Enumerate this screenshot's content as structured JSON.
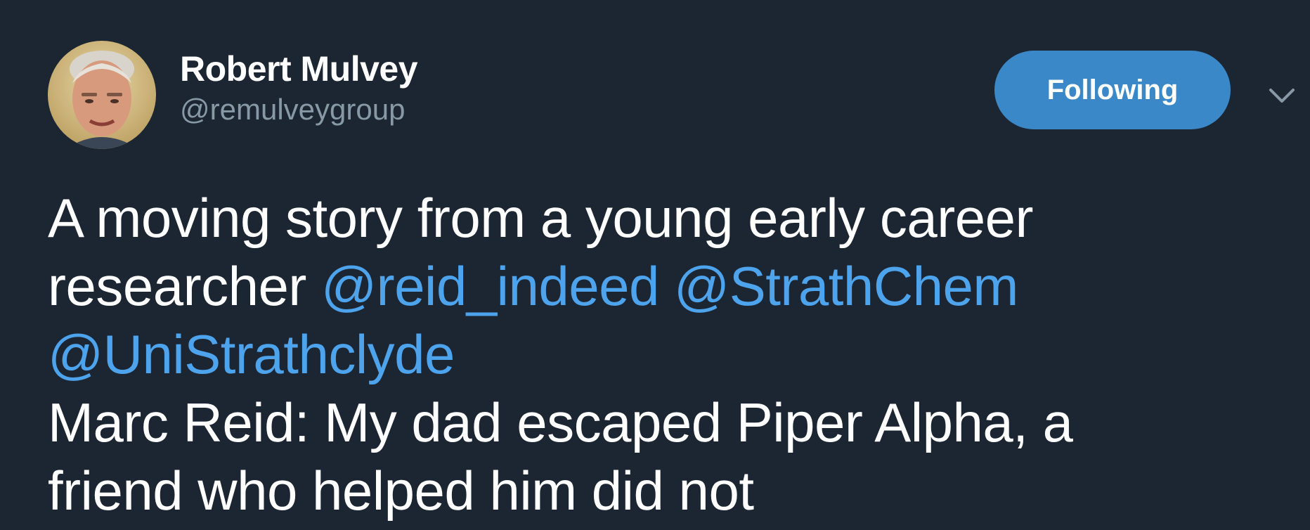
{
  "author": {
    "display_name": "Robert Mulvey",
    "handle": "@remulveygroup",
    "avatar_icon": "person-photo-avatar"
  },
  "actions": {
    "follow_label": "Following",
    "menu_icon": "chevron-down-icon"
  },
  "tweet": {
    "line1": "A moving story from a young early career",
    "line2_prefix": "researcher ",
    "mention1": "@reid_indeed",
    "space1": " ",
    "mention2": "@StrathChem",
    "mention3": "@UniStrathclyde",
    "line4": "Marc Reid: My dad escaped Piper Alpha, a",
    "line5": "friend who helped him did not"
  },
  "colors": {
    "background": "#1c2633",
    "accent": "#4da3ec",
    "button": "#3b88c8",
    "muted": "#8899a6"
  }
}
